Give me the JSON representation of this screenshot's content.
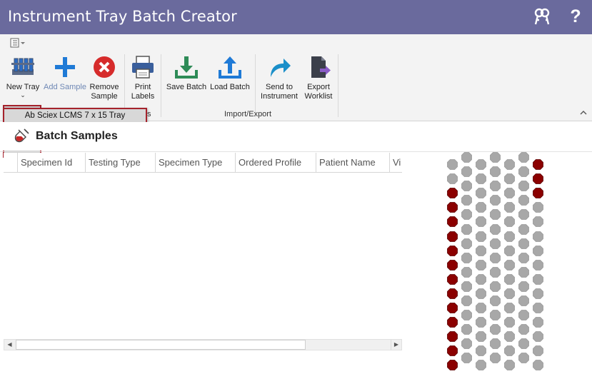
{
  "window": {
    "title": "Instrument Tray Batch Creator",
    "icons": [
      "keys-icon",
      "help-icon"
    ]
  },
  "ribbon": {
    "buttons": [
      {
        "label": "New Tray",
        "icon": "test-tube-rack-icon",
        "state": "pressed"
      },
      {
        "label": "Add Sample",
        "icon": "plus-icon",
        "state": "disabled"
      },
      {
        "label": "Remove Sample",
        "icon": "remove-circle-icon"
      },
      {
        "label": "Print Labels",
        "icon": "printer-icon"
      },
      {
        "label": "Save Batch",
        "icon": "download-icon"
      },
      {
        "label": "Load Batch",
        "icon": "upload-icon"
      },
      {
        "label": "Send to Instrument",
        "icon": "share-arrow-icon"
      },
      {
        "label": "Export Worklist",
        "icon": "export-file-icon"
      }
    ],
    "groups": {
      "partial": "s",
      "import_export": "Import/Export"
    },
    "new_tray_dropdown": {
      "items": [
        "Ab Sciex LCMS 7 x 15 Tray"
      ]
    }
  },
  "samples": {
    "title": "Batch Samples",
    "columns": [
      "Specimen Id",
      "Testing Type",
      "Specimen Type",
      "Ordered Profile",
      "Patient Name",
      "Vi"
    ],
    "rows": []
  },
  "tray": {
    "columns": 7,
    "rows": 15,
    "filled_color": "#8b0000",
    "empty_color": "#a8a8a8",
    "filled_wells": {
      "0": [
        2,
        3,
        4,
        5,
        6,
        7,
        8,
        9,
        10,
        11,
        12,
        13,
        14
      ],
      "6": [
        0,
        1,
        2
      ]
    }
  },
  "colors": {
    "title_bar": "#6a6a9d",
    "highlight_border": "#a5222c",
    "blue_icon": "#1f7ad6",
    "red_icon": "#d62b2b",
    "green_icon": "#2e8b57"
  }
}
